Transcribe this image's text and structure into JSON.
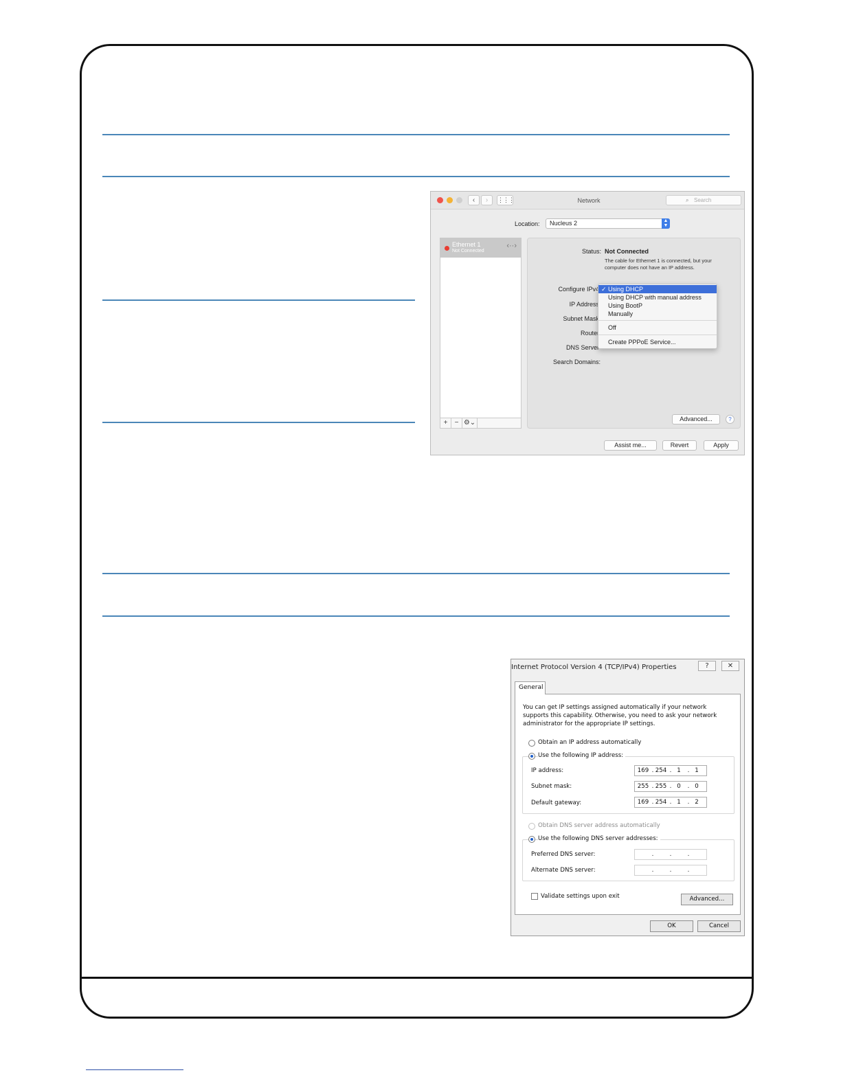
{
  "mac_network": {
    "window_title": "Network",
    "search_placeholder": "Search",
    "back_icon": "chevron-left-icon",
    "forward_icon": "chevron-right-icon",
    "grid_icon": "show-all-grid-icon",
    "location_label": "Location:",
    "location_value": "Nucleus 2",
    "service": {
      "name": "Ethernet 1",
      "status": "Not Connected",
      "status_color": "#e83c31"
    },
    "list_controls": {
      "add": "+",
      "remove": "−",
      "gear": "⚙⌄"
    },
    "status_label": "Status:",
    "status_value": "Not Connected",
    "status_note": "The cable for Ethernet 1 is connected, but your computer does not have an IP address.",
    "configure_label": "Configure IPv4",
    "fields": {
      "ip_address": "IP Address",
      "subnet_mask": "Subnet Mask",
      "router": "Router",
      "dns_server": "DNS Server",
      "search_domains": "Search Domains:"
    },
    "configure_options": {
      "selected": "Using DHCP",
      "opt2": "Using DHCP with manual address",
      "opt3": "Using BootP",
      "opt4": "Manually",
      "opt5": "Off",
      "opt6": "Create PPPoE Service..."
    },
    "buttons": {
      "advanced": "Advanced...",
      "help": "?",
      "assist": "Assist me...",
      "revert": "Revert",
      "apply": "Apply"
    }
  },
  "win_ipv4": {
    "title": "Internet Protocol Version 4 (TCP/IPv4) Properties",
    "help_icon": "?",
    "close_icon": "✕",
    "tab": "General",
    "intro": "You can get IP settings assigned automatically if your network supports this capability. Otherwise, you need to ask your network administrator for the appropriate IP settings.",
    "obtain_ip_auto": "Obtain an IP address automatically",
    "use_following_ip": "Use the following IP address:",
    "ip_address_label": "IP address:",
    "ip_address": [
      "169",
      "254",
      "1",
      "1"
    ],
    "subnet_mask_label": "Subnet mask:",
    "subnet_mask": [
      "255",
      "255",
      "0",
      "0"
    ],
    "gateway_label": "Default gateway:",
    "gateway": [
      "169",
      "254",
      "1",
      "2"
    ],
    "obtain_dns_auto": "Obtain DNS server address automatically",
    "use_following_dns": "Use the following DNS server addresses:",
    "preferred_dns_label": "Preferred DNS server:",
    "alternate_dns_label": "Alternate DNS server:",
    "validate_label": "Validate settings upon exit",
    "advanced": "Advanced...",
    "ok": "OK",
    "cancel": "Cancel"
  }
}
